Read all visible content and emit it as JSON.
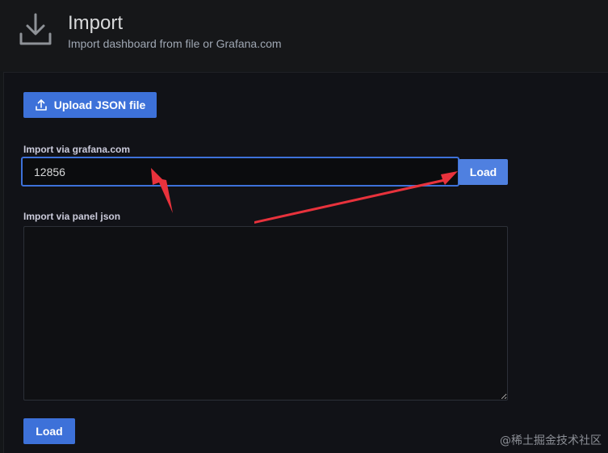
{
  "header": {
    "title": "Import",
    "subtitle": "Import dashboard from file or Grafana.com",
    "icon": "download-icon"
  },
  "upload": {
    "label": "Upload JSON file",
    "icon": "upload-icon"
  },
  "grafana_import": {
    "label": "Import via grafana.com",
    "value": "12856",
    "load_label": "Load"
  },
  "panel_json": {
    "label": "Import via panel json",
    "value": ""
  },
  "bottom_load": {
    "label": "Load"
  },
  "watermark": "@稀土掘金技术社区",
  "colors": {
    "accent": "#3d71d9",
    "annotation_arrow": "#e8323c",
    "background": "#141619"
  }
}
